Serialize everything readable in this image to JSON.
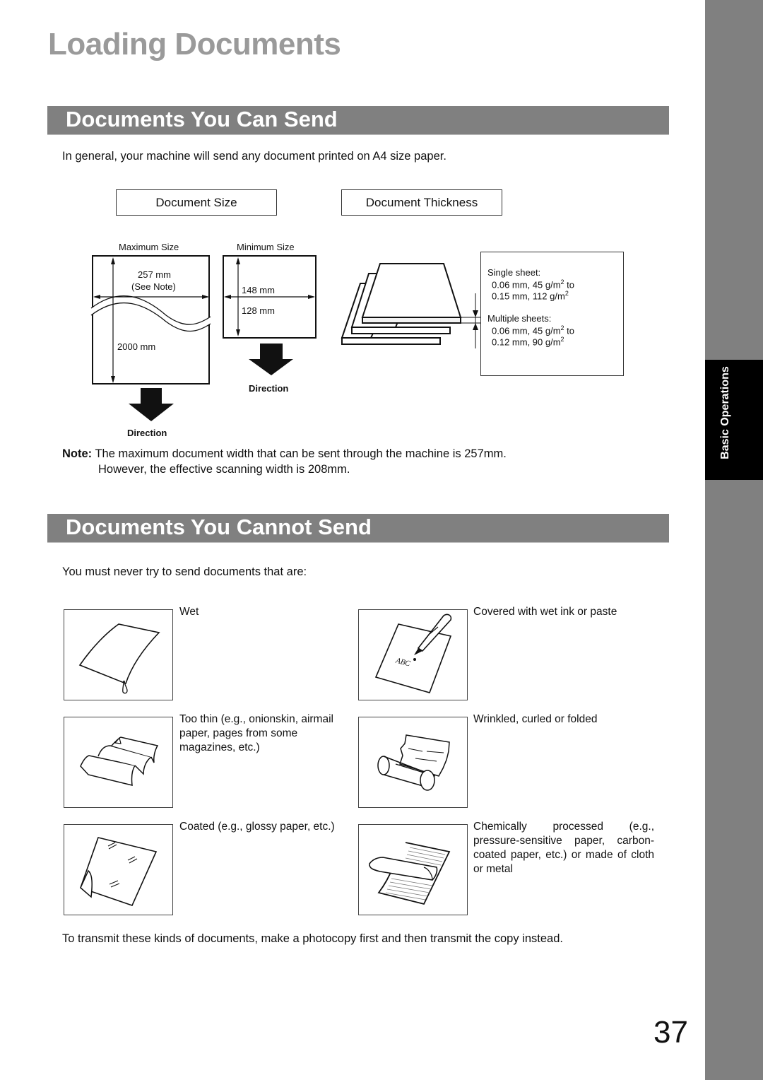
{
  "page": {
    "title": "Loading Documents",
    "page_number": "37",
    "side_tab": "Basic Operations"
  },
  "can_send": {
    "heading": "Documents You Can Send",
    "intro": "In general, your machine will send any document printed on A4 size paper.",
    "size_label": "Document Size",
    "thickness_label": "Document Thickness",
    "max_size": {
      "label": "Maximum Size",
      "width": "257 mm",
      "width_note": "(See Note)",
      "length": "2000 mm",
      "direction": "Direction"
    },
    "min_size": {
      "label": "Minimum Size",
      "width": "148 mm",
      "length": "128 mm",
      "direction": "Direction"
    },
    "thickness": {
      "single_label": "Single sheet:",
      "single_line1_a": "0.06 mm, 45 g/m",
      "single_line1_b": " to",
      "single_line2": "0.15 mm, 112 g/m",
      "multi_label": "Multiple sheets:",
      "multi_line1_a": "0.06 mm, 45 g/m",
      "multi_line1_b": " to",
      "multi_line2": "0.12 mm, 90 g/m",
      "superscript": "2"
    },
    "note_label": "Note:",
    "note_line1": "The maximum document width that can be sent through the machine is 257mm.",
    "note_line2": "However, the effective scanning width is 208mm."
  },
  "cannot_send": {
    "heading": "Documents You Cannot Send",
    "intro": "You must never try to send documents that are:",
    "items": [
      {
        "label": "Wet",
        "icon": "wet-paper-icon"
      },
      {
        "label": "Covered with wet ink or paste",
        "icon": "ink-pen-paper-icon",
        "sample_text": "ABC"
      },
      {
        "label": "Too thin (e.g., onionskin, airmail paper, pages from some magazines, etc.)",
        "icon": "thin-paper-icon"
      },
      {
        "label": "Wrinkled, curled or folded",
        "icon": "wrinkled-paper-icon"
      },
      {
        "label": "Coated (e.g., glossy paper, etc.)",
        "icon": "glossy-paper-icon"
      },
      {
        "label": "Chemically processed (e.g., pressure-sensitive paper, carbon-coated paper, etc.) or made of cloth or metal",
        "icon": "carbon-paper-icon"
      }
    ],
    "footer": "To transmit these kinds of documents, make a photocopy first and then transmit the copy instead."
  }
}
